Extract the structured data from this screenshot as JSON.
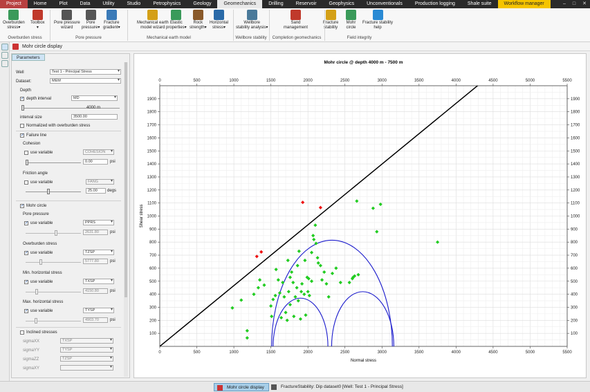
{
  "menubar": {
    "tabs": [
      "Project",
      "Home",
      "Plot",
      "Data",
      "Utility",
      "Studio",
      "Petrophysics",
      "Geology",
      "Geomechanics",
      "Drilling",
      "Reservoir",
      "Geophysics",
      "Unconventionals",
      "Production logging",
      "Shale suite",
      "Workflow manager"
    ],
    "active": "Geomechanics",
    "window_controls": [
      "–",
      "□",
      "✕"
    ]
  },
  "ribbon": {
    "buttons": [
      {
        "id": "overburden",
        "l1": "Overburden",
        "l2": "stress▾",
        "color": "#3a9a5a"
      },
      {
        "id": "toolbox",
        "l1": "Toolbox",
        "l2": "▾",
        "color": "#c0392b"
      },
      {
        "id": "pore-wizard",
        "l1": "Pore pressure",
        "l2": "wizard",
        "color": "#555"
      },
      {
        "id": "pore",
        "l1": "Pore",
        "l2": "pressure▾",
        "color": "#555"
      },
      {
        "id": "fracgrad",
        "l1": "Fracture",
        "l2": "gradient▾",
        "color": "#3a7ab8"
      },
      {
        "id": "mechwiz",
        "l1": "Mechanical earth",
        "l2": "model wizard",
        "color": "#d4a017"
      },
      {
        "id": "elastic",
        "l1": "Elastic",
        "l2": "properties▾",
        "color": "#3a9a5a"
      },
      {
        "id": "rock",
        "l1": "Rock",
        "l2": "strength▾",
        "color": "#8a5a2a"
      },
      {
        "id": "hstress",
        "l1": "Horizontal",
        "l2": "stress▾",
        "color": "#2a6aa8"
      },
      {
        "id": "wellbore",
        "l1": "Wellbore",
        "l2": "stability analysis▾",
        "color": "#4a7a9a"
      },
      {
        "id": "sand",
        "l1": "Sand",
        "l2": "management",
        "color": "#c0392b"
      },
      {
        "id": "fracstab",
        "l1": "Fracture",
        "l2": "stability",
        "color": "#d4a017"
      },
      {
        "id": "mohr",
        "l1": "Mohr",
        "l2": "circle",
        "color": "#3a9a5a"
      },
      {
        "id": "fsh",
        "l1": "Fracture stability",
        "l2": "help",
        "color": "#2a8ad4"
      }
    ],
    "groups": [
      "Overburden stress",
      "Pore pressure",
      "Mechanical earth model",
      "Wellbore stability",
      "Completion geomechanics",
      "Field integrity"
    ]
  },
  "doc_title": "Mohr circle display",
  "params": {
    "tab": "Parameters",
    "well_label": "Well",
    "well_value": "Test 1 - Principal Stress",
    "dataset_label": "Dataset:",
    "dataset_value": "MEM",
    "depth_label": "Depth",
    "depth_interval": "depth interval",
    "depth_mode": "MD",
    "depth_value": "4000 m",
    "interval_label": "interval size",
    "interval_value": "3500.00",
    "normalized": "Normalized with overburden stress",
    "failure": "Failure line",
    "cohesion": "Cohesion",
    "use_variable": "use variable",
    "cohesion_var": "COHESION",
    "cohesion_val": "0.00",
    "psi": "psi",
    "friction": "Friction angle",
    "friction_var": "FANG",
    "friction_val": "25.00",
    "degs": "degs",
    "mohr": "Mohr circle",
    "pore": "Pore pressure",
    "pore_var": "PPRS",
    "pore_val": "2631.80",
    "over": "Overburden stress",
    "over_var": "TZSP",
    "over_val": "5777.80",
    "minh": "Min. horizontal stress",
    "minh_var": "TXSP",
    "minh_val": "4150.80",
    "maxh": "Max. horizontal stress",
    "maxh_var": "TYSP",
    "maxh_val": "4903.70",
    "inclined": "Inclined stresses",
    "sigmas": [
      [
        "sigmaXX",
        "TXSP"
      ],
      [
        "sigmaYY",
        "TYSP"
      ],
      [
        "sigmaZZ",
        "TZSP"
      ],
      [
        "sigmaXY",
        ""
      ]
    ]
  },
  "chart_data": {
    "type": "scatter",
    "title": "Mohr circle @ depth 4000 m - 7500 m",
    "xlabel": "Normal stress",
    "ylabel": "Shear stress",
    "xlim": [
      0,
      5500
    ],
    "ylim": [
      0,
      2000
    ],
    "xticks": [
      0,
      500,
      1000,
      1500,
      2000,
      2500,
      3000,
      3500,
      4000,
      4500,
      5000,
      5500
    ],
    "yticks": [
      100,
      200,
      300,
      400,
      500,
      600,
      700,
      800,
      900,
      1000,
      1100,
      1200,
      1300,
      1400,
      1500,
      1600,
      1700,
      1800,
      1900
    ],
    "failure_line": {
      "x": [
        0,
        4300
      ],
      "y": [
        0,
        2005
      ],
      "color": "#000000"
    },
    "circles": [
      {
        "c": 1900,
        "r": 370
      },
      {
        "c": 2325,
        "r": 815
      },
      {
        "c": 2740,
        "r": 420
      }
    ],
    "circle_color": "#1a1acc",
    "green_color": "#22cc22",
    "red_color": "#ee1111",
    "points_red": [
      [
        1310,
        690
      ],
      [
        1370,
        725
      ],
      [
        1930,
        1105
      ],
      [
        2170,
        1065
      ]
    ],
    "points_green": [
      [
        980,
        295
      ],
      [
        1100,
        355
      ],
      [
        1180,
        65
      ],
      [
        1180,
        120
      ],
      [
        1270,
        400
      ],
      [
        1330,
        450
      ],
      [
        1350,
        510
      ],
      [
        1410,
        470
      ],
      [
        1500,
        310
      ],
      [
        1510,
        230
      ],
      [
        1530,
        360
      ],
      [
        1560,
        390
      ],
      [
        1570,
        590
      ],
      [
        1600,
        510
      ],
      [
        1620,
        410
      ],
      [
        1640,
        220
      ],
      [
        1660,
        490
      ],
      [
        1680,
        380
      ],
      [
        1700,
        260
      ],
      [
        1720,
        200
      ],
      [
        1730,
        660
      ],
      [
        1740,
        420
      ],
      [
        1760,
        530
      ],
      [
        1760,
        320
      ],
      [
        1780,
        570
      ],
      [
        1800,
        490
      ],
      [
        1810,
        230
      ],
      [
        1830,
        380
      ],
      [
        1850,
        450
      ],
      [
        1860,
        620
      ],
      [
        1870,
        350
      ],
      [
        1880,
        730
      ],
      [
        1900,
        210
      ],
      [
        1910,
        420
      ],
      [
        1920,
        480
      ],
      [
        1950,
        400
      ],
      [
        1960,
        660
      ],
      [
        1970,
        240
      ],
      [
        1990,
        530
      ],
      [
        2000,
        420
      ],
      [
        2010,
        520
      ],
      [
        2020,
        390
      ],
      [
        2050,
        500
      ],
      [
        2050,
        720
      ],
      [
        2070,
        850
      ],
      [
        2080,
        820
      ],
      [
        2100,
        930
      ],
      [
        2110,
        790
      ],
      [
        2130,
        680
      ],
      [
        2140,
        640
      ],
      [
        2170,
        620
      ],
      [
        2190,
        510
      ],
      [
        2220,
        570
      ],
      [
        2250,
        480
      ],
      [
        2280,
        380
      ],
      [
        2330,
        560
      ],
      [
        2380,
        600
      ],
      [
        2440,
        490
      ],
      [
        2560,
        490
      ],
      [
        2600,
        520
      ],
      [
        2610,
        530
      ],
      [
        2630,
        540
      ],
      [
        2660,
        1115
      ],
      [
        2680,
        550
      ],
      [
        2880,
        1060
      ],
      [
        2930,
        880
      ],
      [
        2980,
        1090
      ],
      [
        3750,
        800
      ]
    ]
  },
  "status": {
    "tab1": "Mohr circle display",
    "tab2": "FractureStability: Dip dataset0 [Well: Test 1 - Principal Stress]"
  }
}
